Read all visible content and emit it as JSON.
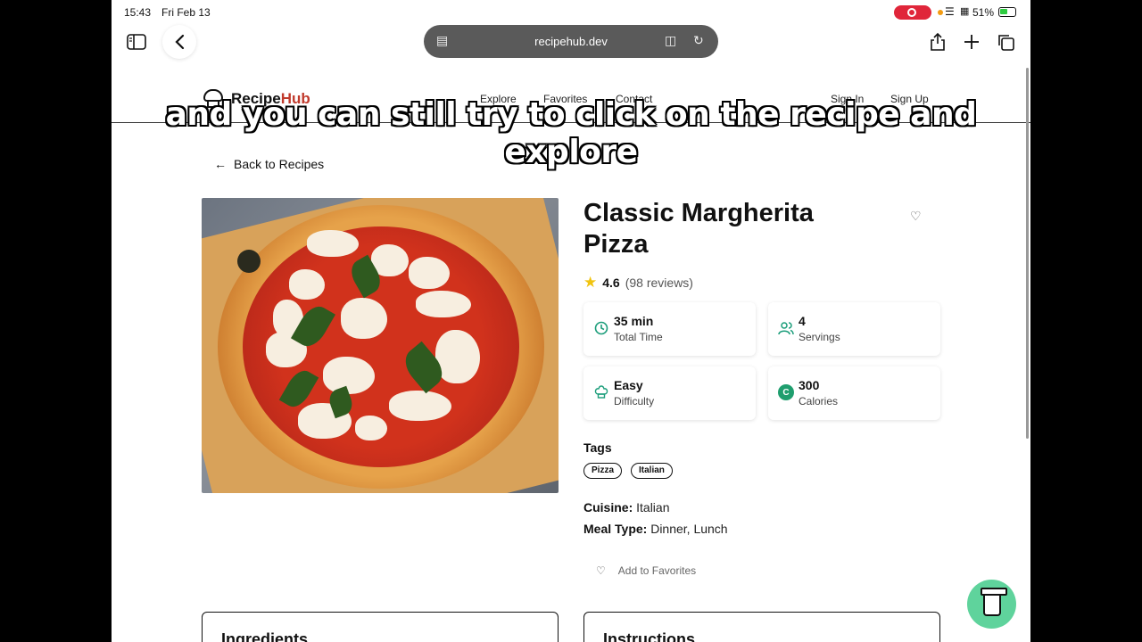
{
  "status_bar": {
    "time": "15:43",
    "date": "Fri Feb 13",
    "battery": "51%"
  },
  "browser": {
    "url": "recipehub.dev"
  },
  "site": {
    "logo_a": "Recipe",
    "logo_b": "Hub",
    "nav": [
      "Explore",
      "Favorites",
      "Contact"
    ],
    "sign_in": "Sign In",
    "sign_up": "Sign Up"
  },
  "caption": "and you can still try to click on the recipe and explore",
  "back_link": "Back to Recipes",
  "recipe": {
    "title": "Classic Margherita Pizza",
    "rating": "4.6",
    "reviews": "(98 reviews)",
    "stats": [
      {
        "value": "35 min",
        "label": "Total Time",
        "icon": "clock-icon"
      },
      {
        "value": "4",
        "label": "Servings",
        "icon": "users-icon"
      },
      {
        "value": "Easy",
        "label": "Difficulty",
        "icon": "chef-hat-icon"
      },
      {
        "value": "300",
        "label": "Calories",
        "icon": "calories-icon",
        "icon_text": "C"
      }
    ],
    "tags_heading": "Tags",
    "tags": [
      "Pizza",
      "Italian"
    ],
    "cuisine_label": "Cuisine:",
    "cuisine": "Italian",
    "meal_label": "Meal Type:",
    "meal": "Dinner, Lunch",
    "add_favorites": "Add to Favorites",
    "sections": [
      "Ingredients",
      "Instructions"
    ]
  },
  "colors": {
    "accent": "#1b9d7a",
    "brand": "#c0392b",
    "fab": "#5fd39c"
  }
}
